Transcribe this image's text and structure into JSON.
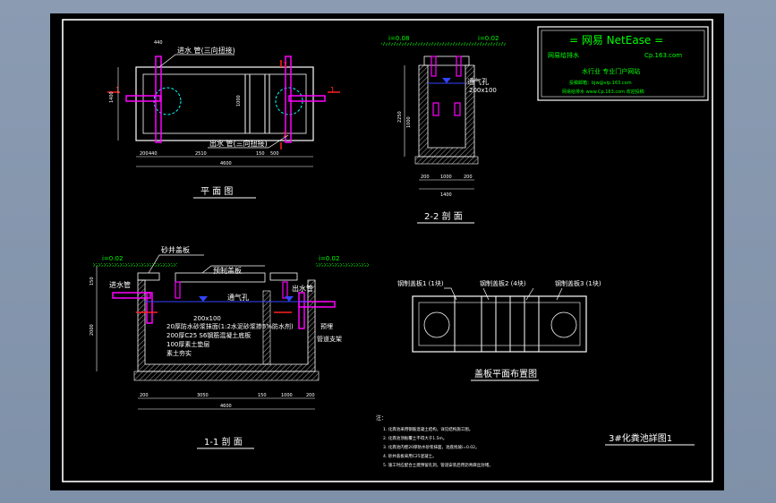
{
  "titles": {
    "plan": "平 面 图",
    "section22": "2-2 剖 面",
    "section11": "1-1 剖 面",
    "coverPlan": "盖板平面布置图",
    "drawing": "3#化粪池詳图1"
  },
  "planLabels": {
    "inlet": "进水 管(三向扭接)",
    "outlet": "出水 管(三向扭接)",
    "mark1": "1",
    "mark2": "2",
    "dim440": "440",
    "dim200": "200",
    "dim2510": "2510",
    "dim150": "150",
    "dim500": "500",
    "dim4600": "4600",
    "dim1400": "1400",
    "dim1000": "1000"
  },
  "section22Labels": {
    "level1": "i=0.08",
    "level2": "i=0.02",
    "vent": "通气孔",
    "ventSize": "200x100",
    "dim2250": "2250",
    "dim1000": "1000",
    "dim1400": "1400",
    "dim200": "200"
  },
  "section11Labels": {
    "level1": "i=0.02",
    "level2": "i=0.02",
    "sandCover": "砂井盖板",
    "precastCover": "预制盖板",
    "inlet": "进水管",
    "outlet": "出水管",
    "vent": "通气孔",
    "ventSize": "200x100",
    "note1": "20厚防水砂浆抹面(1:2水泥砂浆掺5%防水剂)",
    "note2": "200厚C25 S6钢筋混凝土底板",
    "note3": "100厚素土垫层",
    "note4": "素土夯实",
    "precast": "预埋",
    "bracket": "管道支架",
    "dim3050": "3050",
    "dim4600": "4600",
    "dim1000": "1000",
    "dim200": "200",
    "dim150": "150",
    "dim2000": "2000"
  },
  "coverLabels": {
    "cover1": "钢制盖板1 (1块)",
    "cover2": "钢制盖板2 (4块)",
    "cover3": "钢制盖板3 (1块)"
  },
  "notes": {
    "heading": "注：",
    "items": [
      "1. 化粪池采用钢筋混凝土结构，详见结构施工图。",
      "2. 化粪池顶板覆土不得大于1.5m。",
      "3. 化粪池内壁20厚防水砂浆抹面，池底找坡i=0.02。",
      "4. 砂井盖板采用C25混凝土。",
      "5. 施工时应配合土建预留孔洞，管道安装后用沥青麻丝封堵。"
    ]
  },
  "logo": {
    "brand": "= 网易 NetEase =",
    "left": "网易给排水",
    "site": "Cp.163.com",
    "line2": "水行业 专业门户网站",
    "line3": "投稿邮箱：bjw@vip.163.com",
    "line4": "网易给排水 www.Cp.163.com 欢迎投稿"
  },
  "colors": {
    "line": "#ffffff",
    "pipe": "#ff00ff",
    "accent": "#00ff00",
    "cyan": "#00ffff",
    "blue": "#3344ff",
    "red": "#ff2020",
    "dim": "#ffffff"
  }
}
